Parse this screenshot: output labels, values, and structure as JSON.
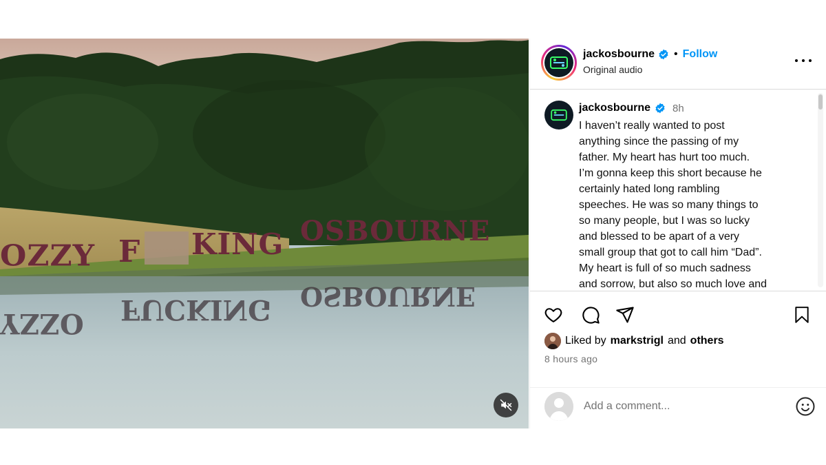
{
  "post": {
    "username": "jackosbourne",
    "verified": true,
    "separator": "•",
    "follow_label": "Follow",
    "audio_label": "Original audio"
  },
  "media": {
    "sign_words": [
      "OZZY",
      "F",
      "KING",
      "OSBOURNE"
    ],
    "reflection_words": [
      "OZZY",
      "FUCKING",
      "OSBOURNE"
    ],
    "muted": true
  },
  "caption": {
    "username": "jackosbourne",
    "time": "8h",
    "lines": [
      "I haven’t really wanted to post",
      "anything since the passing of my",
      "father. My heart has hurt too much.",
      "I’m gonna keep this short because he",
      "certainly hated long rambling",
      "speeches. He was so many things to",
      "so many people, but I was so lucky",
      "and blessed to be apart of a very",
      "small group that got to call him “Dad”.",
      "My heart is full of so much sadness",
      "and sorrow, but also so much love and"
    ]
  },
  "likes": {
    "prefix": "Liked by",
    "user": "markstrigl",
    "conjunction": "and",
    "others": "others"
  },
  "posted_ago": "8 hours ago",
  "comment": {
    "placeholder": "Add a comment..."
  },
  "icons": [
    "verified-badge-icon",
    "more-options-icon",
    "heart-icon",
    "comment-icon",
    "share-icon",
    "bookmark-icon",
    "emoji-icon",
    "mute-icon"
  ],
  "colors": {
    "accent": "#0095f6",
    "muted_text": "#737373",
    "border": "#dbdbdb"
  }
}
